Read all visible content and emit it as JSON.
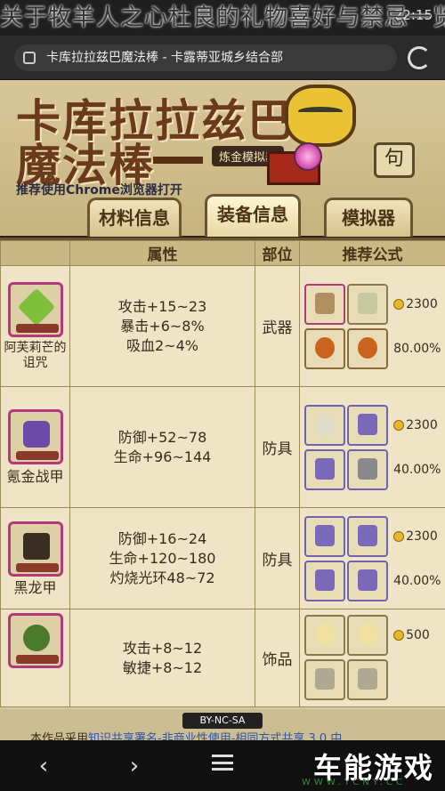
{
  "overlay_title": "关于牧羊人之心杜良的礼物喜好与禁忌一览",
  "statusbar": {
    "time": "22:15"
  },
  "browser": {
    "url": "卡库拉拉兹巴魔法棒 - 卡露蒂亚城乡结合部"
  },
  "banner": {
    "title_line1": "卡库拉拉兹巴",
    "title_line2": "魔法棒",
    "subtitle": "炼金模拟器",
    "hint": "推荐使用Chrome浏览器打开",
    "back_label": "句"
  },
  "tabs": [
    {
      "label": "材料信息"
    },
    {
      "label": "装备信息"
    },
    {
      "label": "模拟器"
    }
  ],
  "table": {
    "headers": [
      "属性",
      "部位",
      "推荐公式"
    ],
    "rows": [
      {
        "name": "阿芙莉芒的诅咒",
        "name_color": "#7fbf3a",
        "attrs": [
          "攻击+15~23",
          "暴击+6~8%",
          "吸血2~4%"
        ],
        "slot": "武器",
        "cost": "2300",
        "rate": "80.00%"
      },
      {
        "name": "氪金战甲",
        "name_color": "#6b4aa8",
        "attrs": [
          "防御+52~78",
          "生命+96~144"
        ],
        "slot": "防具",
        "cost": "2300",
        "rate": "40.00%"
      },
      {
        "name": "黑龙甲",
        "name_color": "#3a2e24",
        "attrs": [
          "防御+16~24",
          "生命+120~180",
          "灼烧光环48~72"
        ],
        "slot": "防具",
        "cost": "2300",
        "rate": "40.00%"
      },
      {
        "name": "",
        "name_color": "#4a7a2a",
        "attrs": [
          "攻击+8~12",
          "敏捷+8~12"
        ],
        "slot": "饰品",
        "cost": "500",
        "rate": ""
      }
    ]
  },
  "footer": {
    "cc_label": "BY-NC-SA",
    "license_prefix": "本作品采用",
    "license_link": "知识共享署名-非商业性使用-相同方式共享 3.0 中"
  },
  "brand": {
    "name": "车能游戏",
    "sub": "WWW.YCNY.CC"
  }
}
